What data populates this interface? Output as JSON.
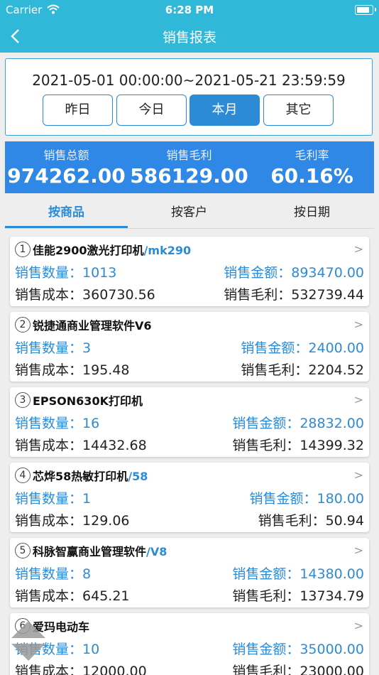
{
  "status": {
    "carrier": "Carrier",
    "time": "6:28 PM"
  },
  "nav": {
    "title": "销售报表"
  },
  "date_range": "2021-05-01 00:00:00~2021-05-21 23:59:59",
  "period_buttons": [
    "昨日",
    "今日",
    "本月",
    "其它"
  ],
  "active_period": "本月",
  "summary": [
    {
      "label": "销售总额",
      "value": "974262.00"
    },
    {
      "label": "销售毛利",
      "value": "586129.00"
    },
    {
      "label": "毛利率",
      "value": "60.16%"
    }
  ],
  "tabs": [
    "按商品",
    "按客户",
    "按日期"
  ],
  "active_tab": "按商品",
  "items": [
    {
      "index": "1",
      "name": "佳能2900激光打印机",
      "code": "/mk290",
      "qty_label": "销售数量：",
      "qty": "1013",
      "amount_label": "销售金额：",
      "amount": "893470.00",
      "cost_label": "销售成本：",
      "cost": "360730.56",
      "profit_label": "销售毛利：",
      "profit": "532739.44"
    },
    {
      "index": "2",
      "name": "锐捷通商业管理软件V6",
      "code": "",
      "qty_label": "销售数量：",
      "qty": "3",
      "amount_label": "销售金额：",
      "amount": "2400.00",
      "cost_label": "销售成本：",
      "cost": "195.48",
      "profit_label": "销售毛利：",
      "profit": "2204.52"
    },
    {
      "index": "3",
      "name": "EPSON630K打印机",
      "code": "",
      "qty_label": "销售数量：",
      "qty": "16",
      "amount_label": "销售金额：",
      "amount": "28832.00",
      "cost_label": "销售成本：",
      "cost": "14432.68",
      "profit_label": "销售毛利：",
      "profit": "14399.32"
    },
    {
      "index": "4",
      "name": "芯烨58热敏打印机",
      "code": "/58",
      "qty_label": "销售数量：",
      "qty": "1",
      "amount_label": "销售金额：",
      "amount": "180.00",
      "cost_label": "销售成本：",
      "cost": "129.06",
      "profit_label": "销售毛利：",
      "profit": "50.94"
    },
    {
      "index": "5",
      "name": "科脉智赢商业管理软件",
      "code": "/V8",
      "qty_label": "销售数量：",
      "qty": "8",
      "amount_label": "销售金额：",
      "amount": "14380.00",
      "cost_label": "销售成本：",
      "cost": "645.21",
      "profit_label": "销售毛利：",
      "profit": "13734.79"
    },
    {
      "index": "6",
      "name": "爱玛电动车",
      "code": "",
      "qty_label": "销售数量：",
      "qty": "10",
      "amount_label": "销售金额：",
      "amount": "35000.00",
      "cost_label": "销售成本：",
      "cost": "12000.00",
      "profit_label": "销售毛利：",
      "profit": "23000.00"
    }
  ],
  "icons": {
    "back": "chevron-left-icon",
    "wifi": "wifi-icon",
    "battery": "battery-icon",
    "row_arrow": "chevron-right-icon",
    "float": "diamond-arrows-icon"
  },
  "colors": {
    "header": "#2fb8d8",
    "accent": "#2d8bd6",
    "summary_bg": "#2f88e5"
  }
}
